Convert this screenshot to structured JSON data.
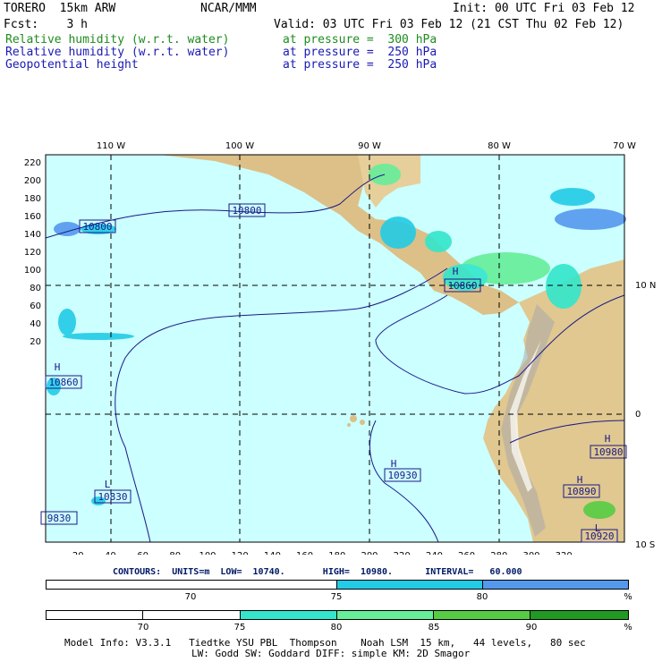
{
  "header": {
    "model": "TORERO  15km ARW",
    "org": "NCAR/MMM",
    "init": "Init: 00 UTC Fri 03 Feb 12",
    "fcst": "Fcst:    3 h",
    "valid": "Valid: 03 UTC Fri 03 Feb 12 (21 CST Thu 02 Feb 12)",
    "fields": [
      {
        "name": "Relative humidity (w.r.t. water)",
        "level": "at pressure =  300 hPa",
        "color": "#1e8c1e"
      },
      {
        "name": "Relative humidity (w.r.t. water)",
        "level": "at pressure =  250 hPa",
        "color": "#1a1ab4"
      },
      {
        "name": "Geopotential height",
        "level": "at pressure =  250 hPa",
        "color": "#1a1ab4"
      }
    ]
  },
  "map": {
    "top_lon_labels": [
      "110 W",
      "100 W",
      "90 W",
      "80 W",
      "70 W"
    ],
    "right_lat_labels": [
      "10 N",
      "0",
      "10 S"
    ],
    "x_ticks": [
      "20",
      "40",
      "60",
      "80",
      "100",
      "120",
      "140",
      "160",
      "180",
      "200",
      "220",
      "240",
      "260",
      "280",
      "300",
      "320"
    ],
    "y_ticks": [
      "220",
      "200",
      "180",
      "160",
      "140",
      "120",
      "100",
      "80",
      "60",
      "40",
      "20"
    ],
    "contour_labels": [
      "10800",
      "10800",
      "10860",
      "10830",
      "9830",
      "10930",
      "10860",
      "10980",
      "10890",
      "10920"
    ],
    "highs_lows": [
      "H",
      "H",
      "H",
      "H",
      "H",
      "L",
      "L"
    ],
    "ocean_color": "#ccffff",
    "land_color": "#e0c890"
  },
  "contours_info": {
    "text": "CONTOURS:  UNITS=m  LOW=  10740.       HIGH=  10980.      INTERVAL=   60.000"
  },
  "colorbar_250": {
    "segments": [
      "#ffffff",
      "#22cce6",
      "#5599ee"
    ],
    "labels": [
      "70",
      "75",
      "80"
    ],
    "unit": "%"
  },
  "colorbar_300": {
    "segments": [
      "#ffffff",
      "#ffffff",
      "#33e6cc",
      "#66ee99",
      "#55cc44",
      "#229922"
    ],
    "labels": [
      "70",
      "75",
      "80",
      "85",
      "90"
    ],
    "unit": "%"
  },
  "footer": {
    "line1": "Model Info: V3.3.1   Tiedtke YSU PBL  Thompson    Noah LSM  15 km,   44 levels,   80 sec",
    "line2": "LW: Godd SW: Goddard DIFF: simple KM: 2D Smagor"
  }
}
